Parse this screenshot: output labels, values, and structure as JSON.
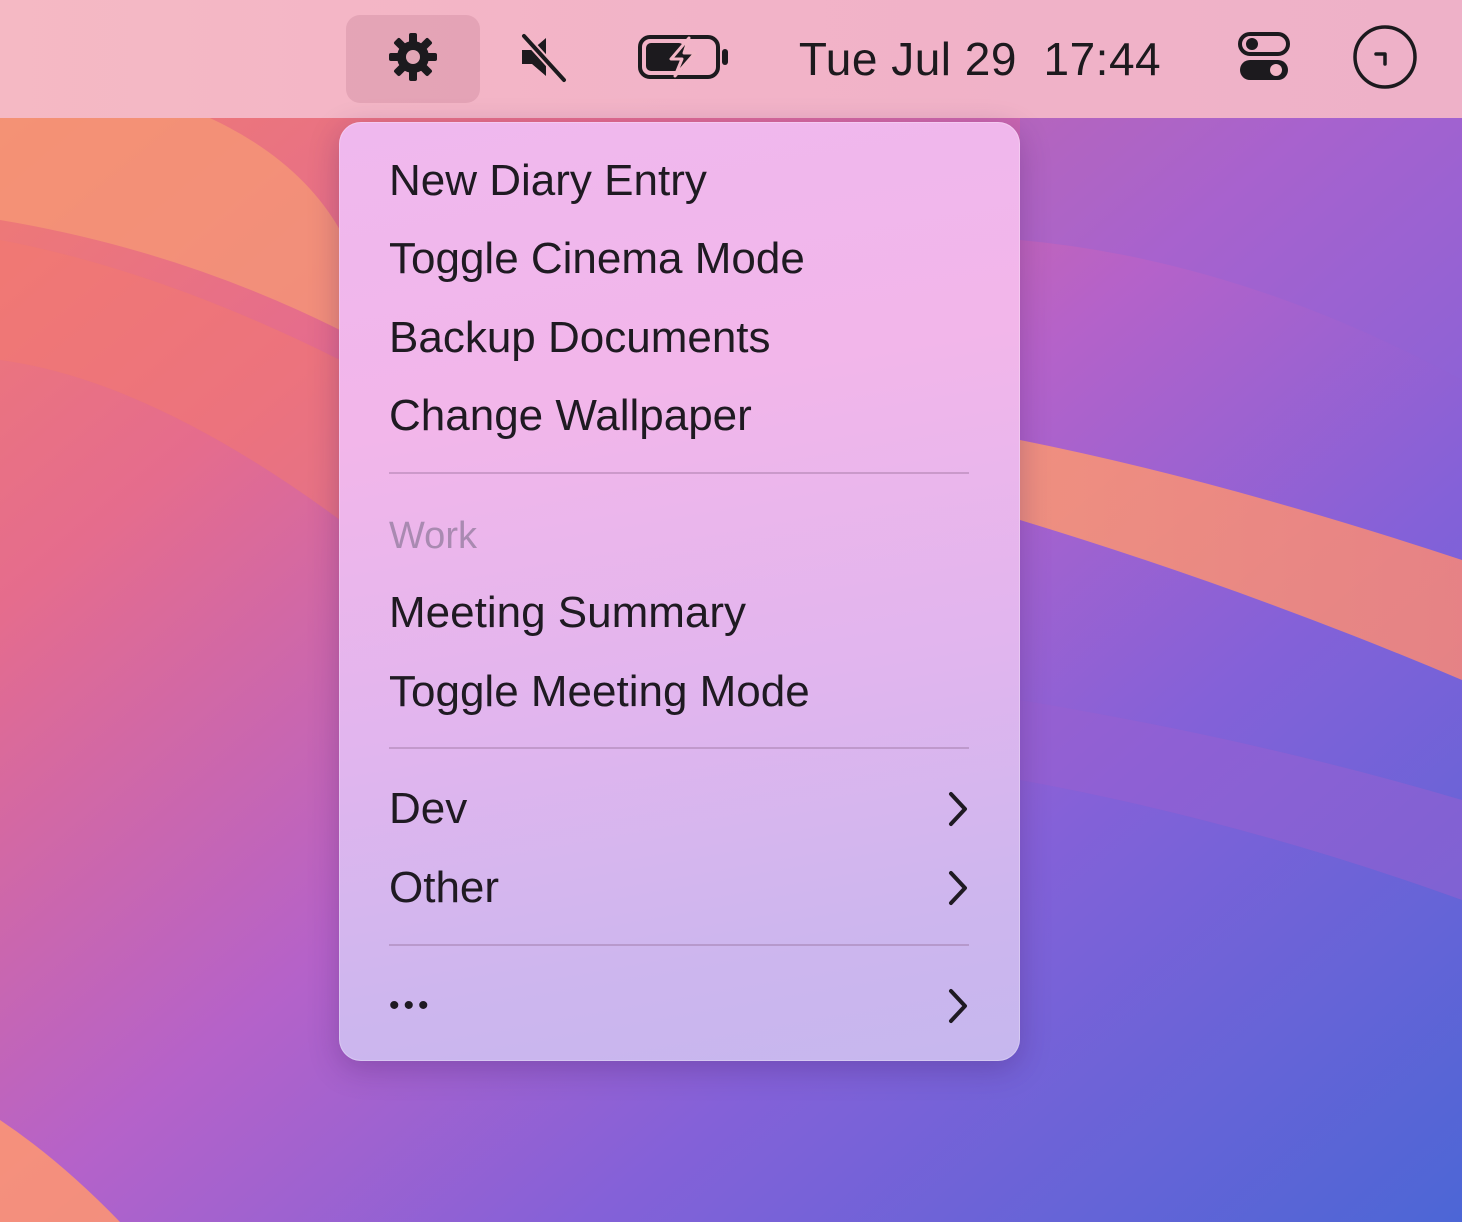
{
  "menubar": {
    "icons": {
      "gear": "gear-icon",
      "mute": "speaker-muted-icon",
      "battery": "battery-charging-icon",
      "control": "control-center-icon",
      "timer": "timer-icon"
    },
    "date": "Tue Jul 29",
    "time": "17:44"
  },
  "menu": {
    "items_top": [
      {
        "label": "New Diary Entry"
      },
      {
        "label": "Toggle Cinema Mode"
      },
      {
        "label": "Backup Documents"
      },
      {
        "label": "Change Wallpaper"
      }
    ],
    "work_header": "Work",
    "items_work": [
      {
        "label": "Meeting Summary"
      },
      {
        "label": "Toggle Meeting Mode"
      }
    ],
    "submenus": [
      {
        "label": "Dev"
      },
      {
        "label": "Other"
      }
    ],
    "more": {
      "label": "•••"
    }
  },
  "colors": {
    "menubar": "#f2b3c8",
    "menu": "#efb8ee",
    "text": "#1f1a22",
    "section_header": "#a98ab1"
  }
}
